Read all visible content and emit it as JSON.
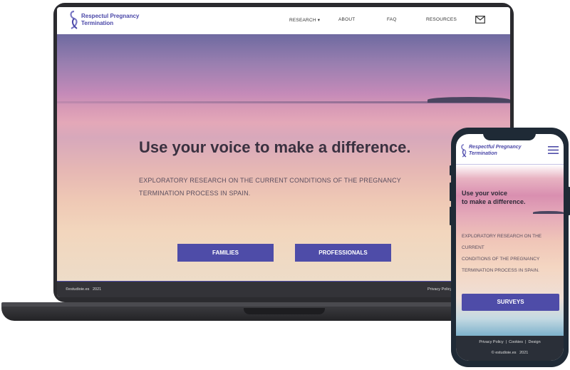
{
  "brand": {
    "name_line1": "Respectul Pregnancy",
    "name_line2": "Termination",
    "mobile_name_line1": "Respectful Pregnancy",
    "mobile_name_line2": "Termination",
    "accent_color": "#4e4ca8"
  },
  "nav": {
    "items": [
      {
        "label": "RESEARCH ▾",
        "icon": "chevron-down-icon"
      },
      {
        "label": "ABOUT"
      },
      {
        "label": "FAQ"
      },
      {
        "label": "RESOURCES"
      }
    ],
    "mail_icon": "mail-icon"
  },
  "hero": {
    "headline": "Use your voice to make a difference.",
    "mobile_headline_line1": "Use your voice",
    "mobile_headline_line2": "to make a difference.",
    "subtitle_line1": "EXPLORATORY RESEARCH ON THE CURRENT CONDITIONS OF THE PREGNANCY",
    "subtitle_line2": "TERMINATION PROCESS IN SPAIN.",
    "mobile_subtitle_line1": "EXPLORATORY RESEARCH ON THE CURRENT",
    "mobile_subtitle_line2": "CONDITIONS OF THE PREGNANCY",
    "mobile_subtitle_line3": "TERMINATION PROCESS IN SPAIN."
  },
  "buttons": {
    "families": "FAMILIES",
    "professionals": "PROFESSIONALS",
    "surveys": "SURVEYS"
  },
  "footer": {
    "copyright": "©estudioie.es   2021",
    "privacy": "Privacy Policy",
    "mobile_links": "Privacy Policy  |  Cookies  |  Design",
    "mobile_copyright": "© estudioie.es   2021"
  }
}
